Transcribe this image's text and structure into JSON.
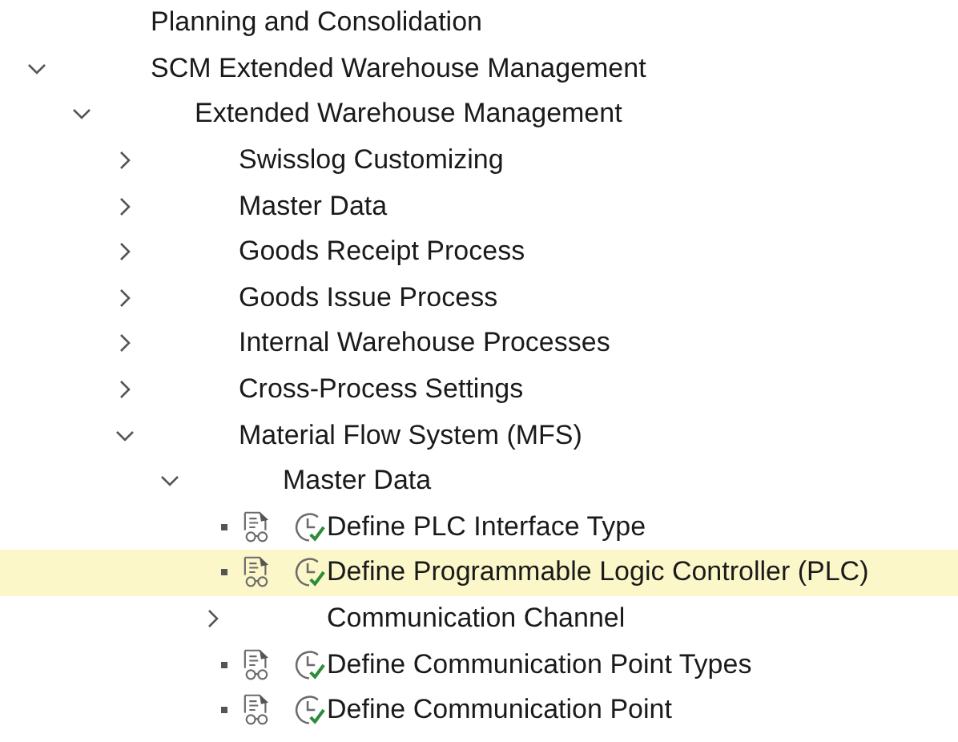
{
  "tree": [
    {
      "kind": "plain",
      "label": "Planning and Consolidation",
      "selected": false
    },
    {
      "kind": "folder",
      "label": "SCM Extended Warehouse Management",
      "expanded": true,
      "selected": false,
      "children": [
        {
          "kind": "folder",
          "label": "Extended Warehouse Management",
          "expanded": true,
          "selected": false,
          "children": [
            {
              "kind": "folder",
              "label": "Swisslog Customizing",
              "expanded": false,
              "selected": false
            },
            {
              "kind": "folder",
              "label": "Master Data",
              "expanded": false,
              "selected": false
            },
            {
              "kind": "folder",
              "label": "Goods Receipt Process",
              "expanded": false,
              "selected": false
            },
            {
              "kind": "folder",
              "label": "Goods Issue Process",
              "expanded": false,
              "selected": false
            },
            {
              "kind": "folder",
              "label": "Internal Warehouse Processes",
              "expanded": false,
              "selected": false
            },
            {
              "kind": "folder",
              "label": "Cross-Process Settings",
              "expanded": false,
              "selected": false
            },
            {
              "kind": "folder",
              "label": "Material Flow System (MFS)",
              "expanded": true,
              "selected": false,
              "children": [
                {
                  "kind": "folder",
                  "label": "Master Data",
                  "expanded": true,
                  "selected": false,
                  "children": [
                    {
                      "kind": "activity",
                      "label": "Define PLC Interface Type",
                      "selected": false
                    },
                    {
                      "kind": "activity",
                      "label": "Define Programmable Logic Controller (PLC)",
                      "selected": true
                    },
                    {
                      "kind": "folder",
                      "label": "Communication Channel",
                      "expanded": false,
                      "selected": false
                    },
                    {
                      "kind": "activity",
                      "label": "Define Communication Point Types",
                      "selected": false
                    },
                    {
                      "kind": "activity",
                      "label": "Define Communication Point",
                      "selected": false
                    }
                  ]
                }
              ]
            }
          ]
        }
      ]
    }
  ]
}
